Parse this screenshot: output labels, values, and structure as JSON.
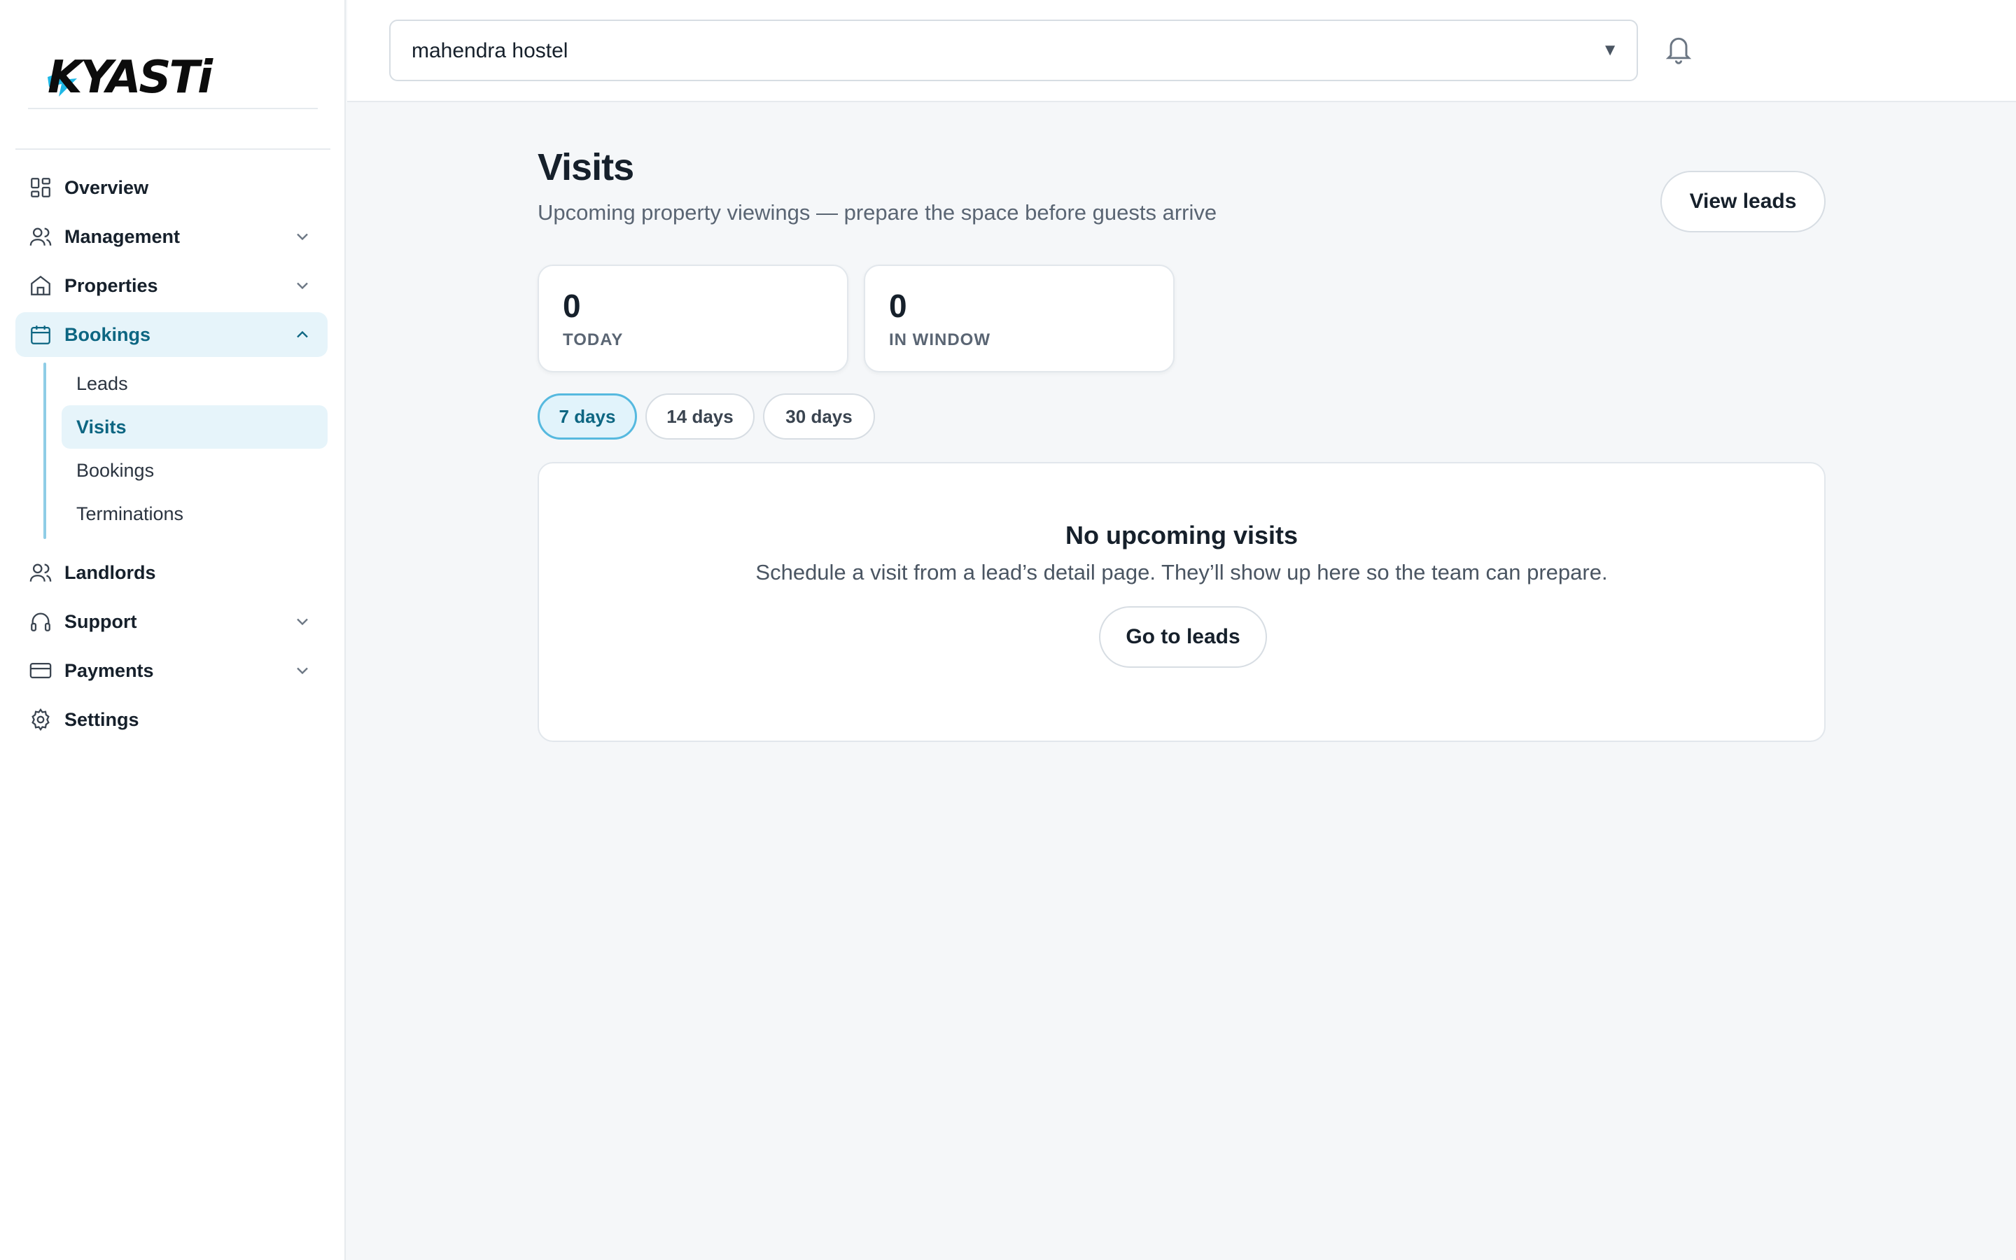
{
  "brand": {
    "logo_text": "KYASTi",
    "accent": "#0d6682",
    "accent_light": "#e6f4fa"
  },
  "sidebar": {
    "items": [
      {
        "label": "Overview",
        "icon": "grid-icon"
      },
      {
        "label": "Management",
        "icon": "users-icon",
        "expandable": true
      },
      {
        "label": "Properties",
        "icon": "home-icon",
        "expandable": true
      },
      {
        "label": "Bookings",
        "icon": "calendar-icon",
        "expandable": true,
        "expanded": true,
        "active": true
      },
      {
        "label": "Landlords",
        "icon": "users-icon"
      },
      {
        "label": "Support",
        "icon": "headphones-icon",
        "expandable": true
      },
      {
        "label": "Payments",
        "icon": "credit-card-icon",
        "expandable": true
      },
      {
        "label": "Settings",
        "icon": "gear-icon"
      }
    ],
    "bookings_sub": [
      {
        "label": "Leads"
      },
      {
        "label": "Visits",
        "active": true
      },
      {
        "label": "Bookings"
      },
      {
        "label": "Terminations"
      }
    ]
  },
  "header": {
    "property_select": {
      "value": "mahendra hostel",
      "caret": "▼"
    }
  },
  "main": {
    "title": "Visits",
    "subtitle": "Upcoming property viewings — prepare the space before guests arrive",
    "view_leads_label": "View leads",
    "stats": [
      {
        "value": "0",
        "label": "TODAY"
      },
      {
        "value": "0",
        "label": "IN WINDOW"
      }
    ],
    "range_chips": [
      {
        "label": "7 days",
        "active": true
      },
      {
        "label": "14 days"
      },
      {
        "label": "30 days"
      }
    ],
    "empty": {
      "title": "No upcoming visits",
      "description": "Schedule a visit from a lead’s detail page. They’ll show up here so the team can prepare.",
      "button_label": "Go to leads"
    }
  }
}
